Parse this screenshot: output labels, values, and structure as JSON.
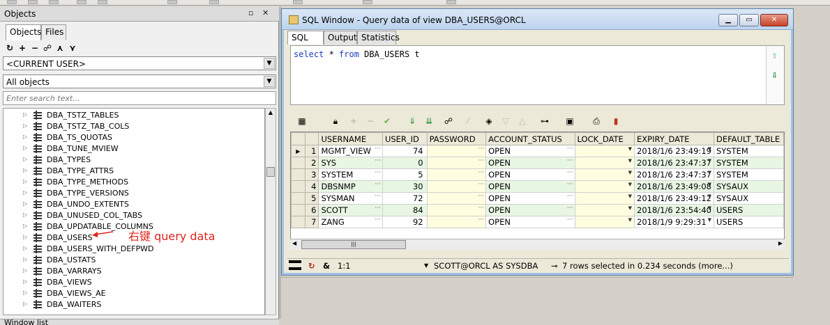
{
  "colors": {
    "accent": "#1a3fb8",
    "annotation": "#e0241c",
    "alt_row": "#e8f6e4",
    "pw_cell": "#fffde0"
  },
  "objects_panel": {
    "title": "Objects",
    "title_controls": [
      "▫",
      "✕"
    ],
    "tabs": [
      {
        "label": "Objects"
      },
      {
        "label": "Files"
      }
    ],
    "toolbar_icons": [
      "refresh-icon",
      "add-icon",
      "remove-icon",
      "find-icon",
      "filter-icon",
      "filter-edit-icon"
    ],
    "user_combo": "<CURRENT USER>",
    "filter_combo": "All objects",
    "search_placeholder": "Enter search text...",
    "tree_items": [
      {
        "label": "DBA_TSTZ_TABLES"
      },
      {
        "label": "DBA_TSTZ_TAB_COLS"
      },
      {
        "label": "DBA_TS_QUOTAS"
      },
      {
        "label": "DBA_TUNE_MVIEW"
      },
      {
        "label": "DBA_TYPES"
      },
      {
        "label": "DBA_TYPE_ATTRS"
      },
      {
        "label": "DBA_TYPE_METHODS"
      },
      {
        "label": "DBA_TYPE_VERSIONS"
      },
      {
        "label": "DBA_UNDO_EXTENTS"
      },
      {
        "label": "DBA_UNUSED_COL_TABS"
      },
      {
        "label": "DBA_UPDATABLE_COLUMNS"
      },
      {
        "label": "DBA_USERS"
      },
      {
        "label": "DBA_USERS_WITH_DEFPWD"
      },
      {
        "label": "DBA_USTATS"
      },
      {
        "label": "DBA_VARRAYS"
      },
      {
        "label": "DBA_VIEWS"
      },
      {
        "label": "DBA_VIEWS_AE"
      },
      {
        "label": "DBA_WAITERS"
      }
    ],
    "annotation": "右键 query data",
    "window_list_title": "Window list"
  },
  "sql_window": {
    "title": "SQL Window - Query data of view DBA_USERS@ORCL",
    "window_buttons": [
      "▁",
      "▭",
      "✕"
    ],
    "tabs": [
      {
        "label": "SQL"
      },
      {
        "label": "Output"
      },
      {
        "label": "Statistics"
      }
    ],
    "query": {
      "kw1": "select",
      "mid": " * ",
      "kw2": "from",
      "rest": " DBA_USERS t"
    },
    "grid_toolbar_icons": [
      "grid-select-icon",
      "lock-icon",
      "add-record-icon",
      "delete-record-icon",
      "post-icon",
      "fetch-next-icon",
      "fetch-all-icon",
      "find-icon",
      "clear-icon",
      "query-by-example-icon",
      "next-icon",
      "previous-icon",
      "export-icon",
      "save-icon",
      "print-icon",
      "chart-icon"
    ],
    "columns": [
      "USERNAME",
      "USER_ID",
      "PASSWORD",
      "ACCOUNT_STATUS",
      "LOCK_DATE",
      "EXPIRY_DATE",
      "DEFAULT_TABLE"
    ],
    "rows": [
      {
        "n": "1",
        "username": "MGMT_VIEW",
        "user_id": "74",
        "password": "",
        "status": "OPEN",
        "lock_date": "",
        "expiry": "2018/1/6 23:49:19",
        "tablespace": "SYSTEM"
      },
      {
        "n": "2",
        "username": "SYS",
        "user_id": "0",
        "password": "",
        "status": "OPEN",
        "lock_date": "",
        "expiry": "2018/1/6 23:47:37",
        "tablespace": "SYSTEM"
      },
      {
        "n": "3",
        "username": "SYSTEM",
        "user_id": "5",
        "password": "",
        "status": "OPEN",
        "lock_date": "",
        "expiry": "2018/1/6 23:47:37",
        "tablespace": "SYSTEM"
      },
      {
        "n": "4",
        "username": "DBSNMP",
        "user_id": "30",
        "password": "",
        "status": "OPEN",
        "lock_date": "",
        "expiry": "2018/1/6 23:49:08",
        "tablespace": "SYSAUX"
      },
      {
        "n": "5",
        "username": "SYSMAN",
        "user_id": "72",
        "password": "",
        "status": "OPEN",
        "lock_date": "",
        "expiry": "2018/1/6 23:49:12",
        "tablespace": "SYSAUX"
      },
      {
        "n": "6",
        "username": "SCOTT",
        "user_id": "84",
        "password": "",
        "status": "OPEN",
        "lock_date": "",
        "expiry": "2018/1/6 23:54:40",
        "tablespace": "USERS"
      },
      {
        "n": "7",
        "username": "ZANG",
        "user_id": "92",
        "password": "",
        "status": "OPEN",
        "lock_date": "",
        "expiry": "2018/1/9 9:29:31",
        "tablespace": "USERS"
      }
    ],
    "status": {
      "position": "1:1",
      "connection": "SCOTT@ORCL AS SYSDBA",
      "message": "7 rows selected in 0.234 seconds (more...)"
    }
  }
}
